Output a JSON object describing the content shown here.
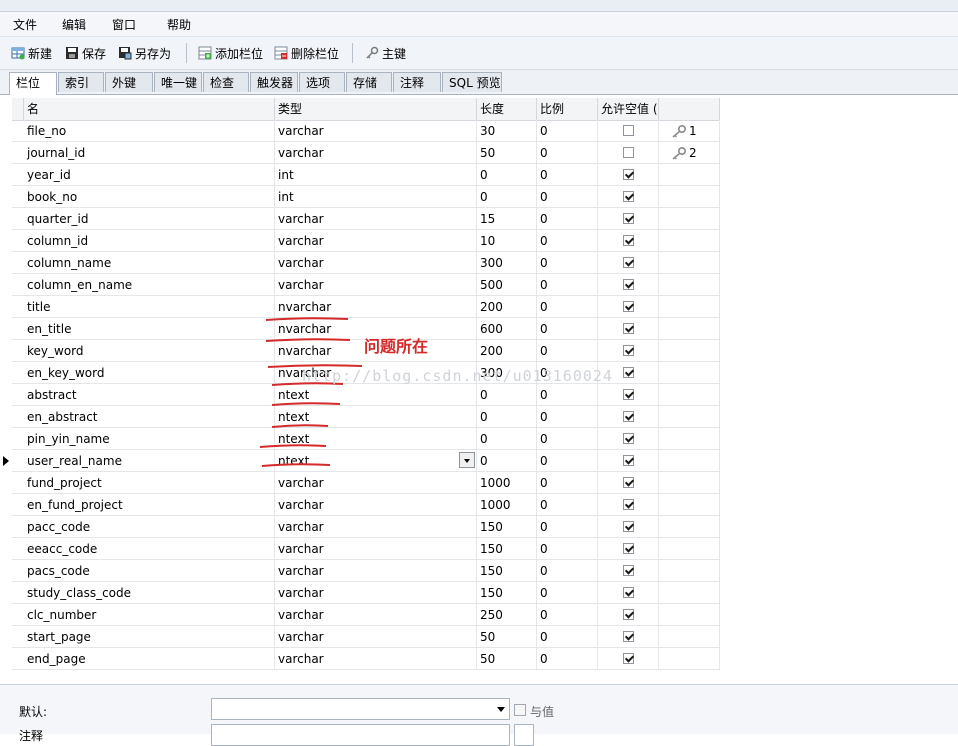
{
  "menu": [
    "文件",
    "编辑",
    "窗口",
    "帮助"
  ],
  "toolbar": {
    "new": "新建",
    "save": "保存",
    "save_as": "另存为",
    "add_column": "添加栏位",
    "delete_column": "删除栏位",
    "primary_key": "主键"
  },
  "tabs": [
    "栏位",
    "索引",
    "外键",
    "唯一键",
    "检查",
    "触发器",
    "选项",
    "存储",
    "注释",
    "SQL 预览"
  ],
  "grid": {
    "headers": [
      "名",
      "类型",
      "长度",
      "比例",
      "允许空值 ("
    ],
    "rows": [
      {
        "name": "file_no",
        "type": "varchar",
        "length": "30",
        "scale": "0",
        "nullable": false,
        "key": "1"
      },
      {
        "name": "journal_id",
        "type": "varchar",
        "length": "50",
        "scale": "0",
        "nullable": false,
        "key": "2"
      },
      {
        "name": "year_id",
        "type": "int",
        "length": "0",
        "scale": "0",
        "nullable": true,
        "key": ""
      },
      {
        "name": "book_no",
        "type": "int",
        "length": "0",
        "scale": "0",
        "nullable": true,
        "key": ""
      },
      {
        "name": "quarter_id",
        "type": "varchar",
        "length": "15",
        "scale": "0",
        "nullable": true,
        "key": ""
      },
      {
        "name": "column_id",
        "type": "varchar",
        "length": "10",
        "scale": "0",
        "nullable": true,
        "key": ""
      },
      {
        "name": "column_name",
        "type": "varchar",
        "length": "300",
        "scale": "0",
        "nullable": true,
        "key": ""
      },
      {
        "name": "column_en_name",
        "type": "varchar",
        "length": "500",
        "scale": "0",
        "nullable": true,
        "key": ""
      },
      {
        "name": "title",
        "type": "nvarchar",
        "length": "200",
        "scale": "0",
        "nullable": true,
        "key": ""
      },
      {
        "name": "en_title",
        "type": "nvarchar",
        "length": "600",
        "scale": "0",
        "nullable": true,
        "key": ""
      },
      {
        "name": "key_word",
        "type": "nvarchar",
        "length": "200",
        "scale": "0",
        "nullable": true,
        "key": ""
      },
      {
        "name": "en_key_word",
        "type": "nvarchar",
        "length": "300",
        "scale": "0",
        "nullable": true,
        "key": ""
      },
      {
        "name": "abstract",
        "type": "ntext",
        "length": "0",
        "scale": "0",
        "nullable": true,
        "key": ""
      },
      {
        "name": "en_abstract",
        "type": "ntext",
        "length": "0",
        "scale": "0",
        "nullable": true,
        "key": ""
      },
      {
        "name": "pin_yin_name",
        "type": "ntext",
        "length": "0",
        "scale": "0",
        "nullable": true,
        "key": ""
      },
      {
        "name": "user_real_name",
        "type": "ntext",
        "length": "0",
        "scale": "0",
        "nullable": true,
        "key": ""
      },
      {
        "name": "fund_project",
        "type": "varchar",
        "length": "1000",
        "scale": "0",
        "nullable": true,
        "key": ""
      },
      {
        "name": "en_fund_project",
        "type": "varchar",
        "length": "1000",
        "scale": "0",
        "nullable": true,
        "key": ""
      },
      {
        "name": "pacc_code",
        "type": "varchar",
        "length": "150",
        "scale": "0",
        "nullable": true,
        "key": ""
      },
      {
        "name": "eeacc_code",
        "type": "varchar",
        "length": "150",
        "scale": "0",
        "nullable": true,
        "key": ""
      },
      {
        "name": "pacs_code",
        "type": "varchar",
        "length": "150",
        "scale": "0",
        "nullable": true,
        "key": ""
      },
      {
        "name": "study_class_code",
        "type": "varchar",
        "length": "150",
        "scale": "0",
        "nullable": true,
        "key": ""
      },
      {
        "name": "clc_number",
        "type": "varchar",
        "length": "250",
        "scale": "0",
        "nullable": true,
        "key": ""
      },
      {
        "name": "start_page",
        "type": "varchar",
        "length": "50",
        "scale": "0",
        "nullable": true,
        "key": ""
      },
      {
        "name": "end_page",
        "type": "varchar",
        "length": "50",
        "scale": "0",
        "nullable": true,
        "key": ""
      }
    ]
  },
  "annotation": "问题所在",
  "watermark": "http://blog.csdn.net/u013160024",
  "bottom": {
    "default_label": "默认:",
    "with_value_label": "与值",
    "comment_label": "注释"
  },
  "colors": {
    "annotation": "#d42a2a"
  }
}
